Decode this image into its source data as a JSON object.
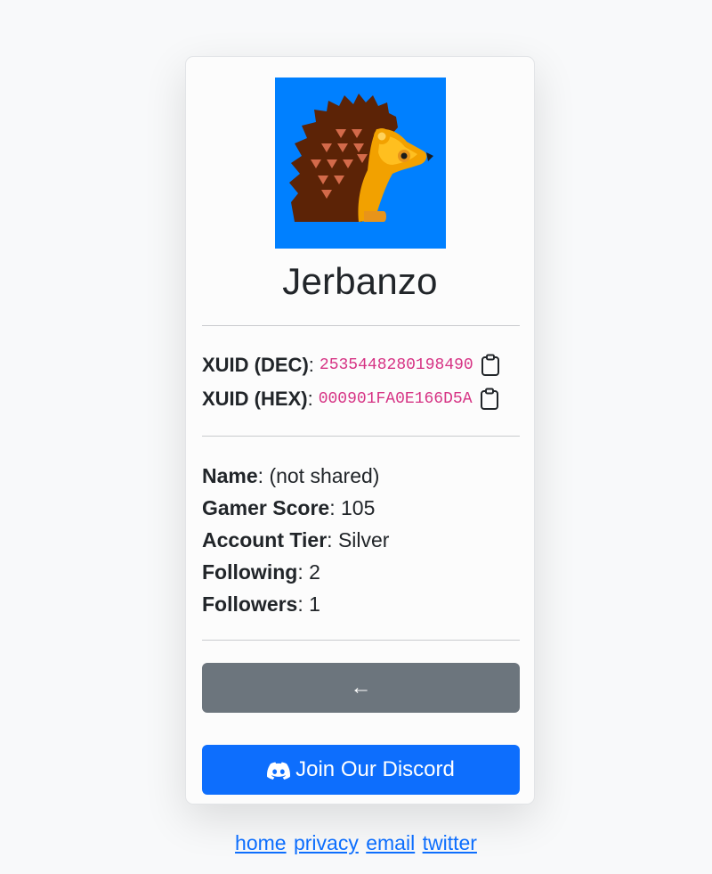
{
  "profile": {
    "gamertag": "Jerbanzo",
    "avatar_icon": "hedgehog-avatar",
    "avatar_bg": "#0080ff"
  },
  "xuid": {
    "dec_label": "XUID (DEC)",
    "dec_value": "2535448280198490",
    "hex_label": "XUID (HEX)",
    "hex_value": "000901FA0E166D5A",
    "copy_icon": "clipboard-icon"
  },
  "info": {
    "name_label": "Name",
    "name_value": "(not shared)",
    "gamerscore_label": "Gamer Score",
    "gamerscore_value": "105",
    "tier_label": "Account Tier",
    "tier_value": "Silver",
    "following_label": "Following",
    "following_value": "2",
    "followers_label": "Followers",
    "followers_value": "1"
  },
  "buttons": {
    "back_label": "←",
    "discord_label": "Join Our Discord",
    "discord_icon": "discord-icon"
  },
  "footer": {
    "links": [
      "home",
      "privacy",
      "email",
      "twitter"
    ]
  },
  "colors": {
    "back_button": "#6c757d",
    "discord_button": "#0d6efd",
    "code": "#d63384",
    "link": "#0d6efd"
  }
}
